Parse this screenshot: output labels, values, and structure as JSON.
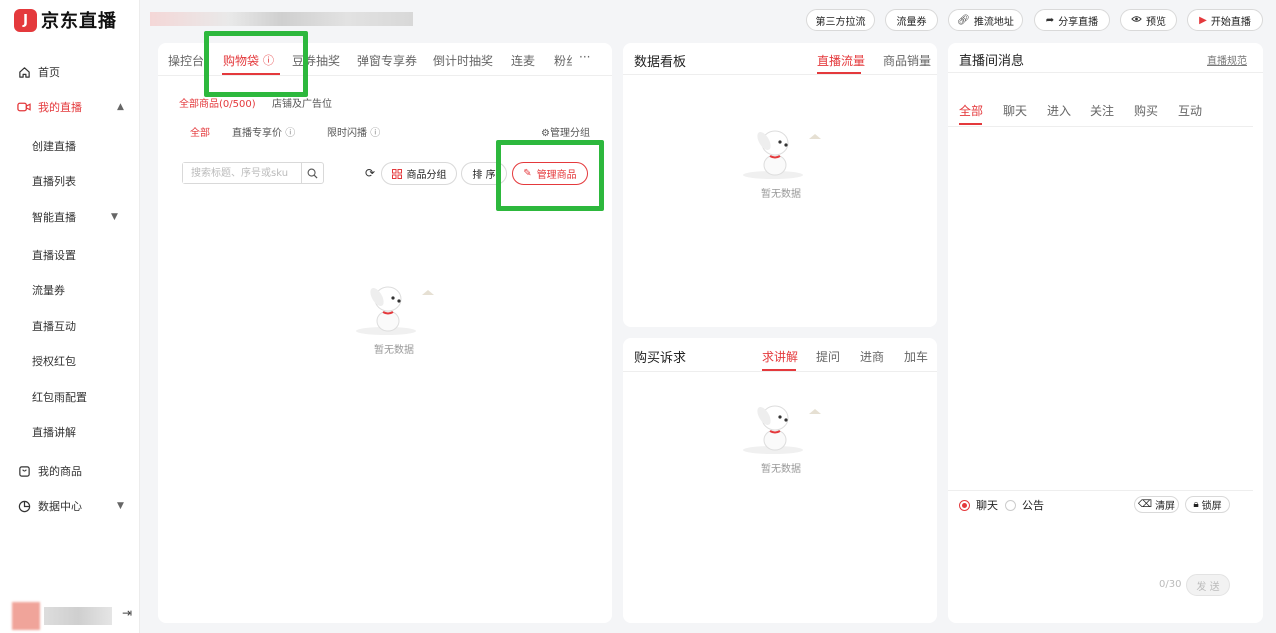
{
  "app": {
    "logo_text": "京东直播",
    "logo_mark": "J"
  },
  "colors": {
    "accent": "#e4393c",
    "highlight": "#2db83d"
  },
  "sidebar": {
    "items": [
      {
        "label": "首页",
        "icon": "home-icon"
      },
      {
        "label": "我的直播",
        "icon": "live-camera-icon"
      },
      {
        "label": "创建直播"
      },
      {
        "label": "直播列表"
      },
      {
        "label": "智能直播"
      },
      {
        "label": "直播设置"
      },
      {
        "label": "流量券"
      },
      {
        "label": "直播互动"
      },
      {
        "label": "授权红包"
      },
      {
        "label": "红包雨配置"
      },
      {
        "label": "直播讲解"
      },
      {
        "label": "我的商品",
        "icon": "product-icon"
      },
      {
        "label": "数据中心",
        "icon": "data-chart-icon"
      }
    ]
  },
  "header": {
    "buttons": [
      {
        "label": "第三方拉流",
        "icon": ""
      },
      {
        "label": "流量券",
        "icon": ""
      },
      {
        "label": "推流地址",
        "icon": "link-icon"
      },
      {
        "label": "分享直播",
        "icon": "share-icon"
      },
      {
        "label": "预览",
        "icon": "eye-icon"
      },
      {
        "label": "开始直播",
        "icon": "play-icon"
      }
    ]
  },
  "left_panel": {
    "tabs": [
      "操控台",
      "购物袋",
      "豆券抽奖",
      "弹窗专享券",
      "倒计时抽奖",
      "连麦",
      "粉丝"
    ],
    "more": "···",
    "subtabs": [
      "全部商品(0/500)",
      "店铺及广告位"
    ],
    "filters": [
      "全部",
      "直播专享价",
      "限时闪播"
    ],
    "manage_group": "管理分组",
    "search_placeholder": "搜索标题、序号或sku",
    "group_button": "商品分组",
    "sort_button": "排 序",
    "manage_button": "管理商品",
    "empty": "暂无数据"
  },
  "data_panel": {
    "title": "数据看板",
    "tabs": [
      "直播流量",
      "商品销量"
    ],
    "empty": "暂无数据"
  },
  "buy_panel": {
    "title": "购买诉求",
    "tabs": [
      "求讲解",
      "提问",
      "进商",
      "加车"
    ],
    "empty": "暂无数据"
  },
  "msg_panel": {
    "title": "直播间消息",
    "rules_link": "直播规范",
    "tabs": [
      "全部",
      "聊天",
      "进入",
      "关注",
      "购买",
      "互动"
    ],
    "radio": [
      "聊天",
      "公告"
    ],
    "clear_button": "清屏",
    "lock_button": "锁屏",
    "counter": "0/30",
    "send_button": "发 送"
  }
}
